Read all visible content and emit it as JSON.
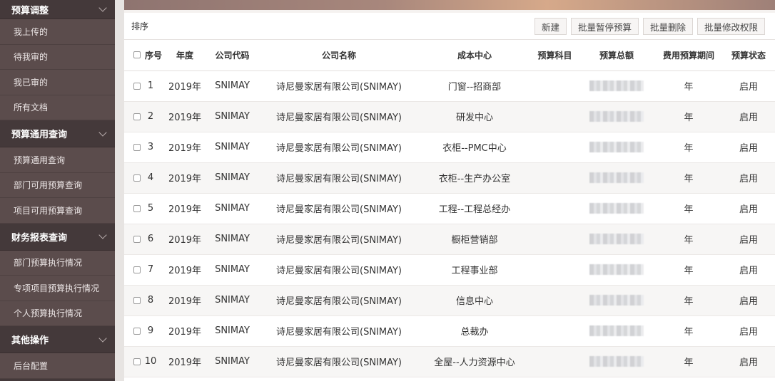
{
  "sidebar": {
    "groups": [
      {
        "title": "预算调整",
        "items": [
          "我上传的",
          "待我审的",
          "我已审的",
          "所有文档"
        ]
      },
      {
        "title": "预算通用查询",
        "items": [
          "预算通用查询",
          "部门可用预算查询",
          "项目可用预算查询"
        ]
      },
      {
        "title": "财务报表查询",
        "items": [
          "部门预算执行情况",
          "专项项目预算执行情况",
          "个人预算执行情况"
        ]
      },
      {
        "title": "其他操作",
        "items": [
          "后台配置"
        ]
      }
    ]
  },
  "toolbar": {
    "title": "排序",
    "buttons": [
      "新建",
      "批量暂停预算",
      "批量删除",
      "批量修改权限"
    ]
  },
  "table": {
    "headers": [
      "序号",
      "年度",
      "公司代码",
      "公司名称",
      "成本中心",
      "预算科目",
      "预算总额",
      "费用预算期间",
      "预算状态"
    ],
    "rows": [
      {
        "seq": "1",
        "year": "2019年",
        "code": "SNIMAY",
        "company": "诗尼曼家居有限公司(SNIMAY)",
        "center": "门窗--招商部",
        "subject": "",
        "period": "年",
        "status": "启用"
      },
      {
        "seq": "2",
        "year": "2019年",
        "code": "SNIMAY",
        "company": "诗尼曼家居有限公司(SNIMAY)",
        "center": "研发中心",
        "subject": "",
        "period": "年",
        "status": "启用"
      },
      {
        "seq": "3",
        "year": "2019年",
        "code": "SNIMAY",
        "company": "诗尼曼家居有限公司(SNIMAY)",
        "center": "衣柜--PMC中心",
        "subject": "",
        "period": "年",
        "status": "启用"
      },
      {
        "seq": "4",
        "year": "2019年",
        "code": "SNIMAY",
        "company": "诗尼曼家居有限公司(SNIMAY)",
        "center": "衣柜--生产办公室",
        "subject": "",
        "period": "年",
        "status": "启用"
      },
      {
        "seq": "5",
        "year": "2019年",
        "code": "SNIMAY",
        "company": "诗尼曼家居有限公司(SNIMAY)",
        "center": "工程--工程总经办",
        "subject": "",
        "period": "年",
        "status": "启用"
      },
      {
        "seq": "6",
        "year": "2019年",
        "code": "SNIMAY",
        "company": "诗尼曼家居有限公司(SNIMAY)",
        "center": "橱柜营销部",
        "subject": "",
        "period": "年",
        "status": "启用"
      },
      {
        "seq": "7",
        "year": "2019年",
        "code": "SNIMAY",
        "company": "诗尼曼家居有限公司(SNIMAY)",
        "center": "工程事业部",
        "subject": "",
        "period": "年",
        "status": "启用"
      },
      {
        "seq": "8",
        "year": "2019年",
        "code": "SNIMAY",
        "company": "诗尼曼家居有限公司(SNIMAY)",
        "center": "信息中心",
        "subject": "",
        "period": "年",
        "status": "启用"
      },
      {
        "seq": "9",
        "year": "2019年",
        "code": "SNIMAY",
        "company": "诗尼曼家居有限公司(SNIMAY)",
        "center": "总裁办",
        "subject": "",
        "period": "年",
        "status": "启用"
      },
      {
        "seq": "10",
        "year": "2019年",
        "code": "SNIMAY",
        "company": "诗尼曼家居有限公司(SNIMAY)",
        "center": "全屋--人力资源中心",
        "subject": "",
        "period": "年",
        "status": "启用"
      }
    ]
  },
  "colors": {
    "sidebar_bg": "#5b4c4c",
    "sidebar_group_bg": "#44393a",
    "accent_gradient": [
      "#8e7470",
      "#d6a98a"
    ]
  },
  "icons": {
    "group_toggle": "chevron-down-icon",
    "row_select": "checkbox"
  }
}
